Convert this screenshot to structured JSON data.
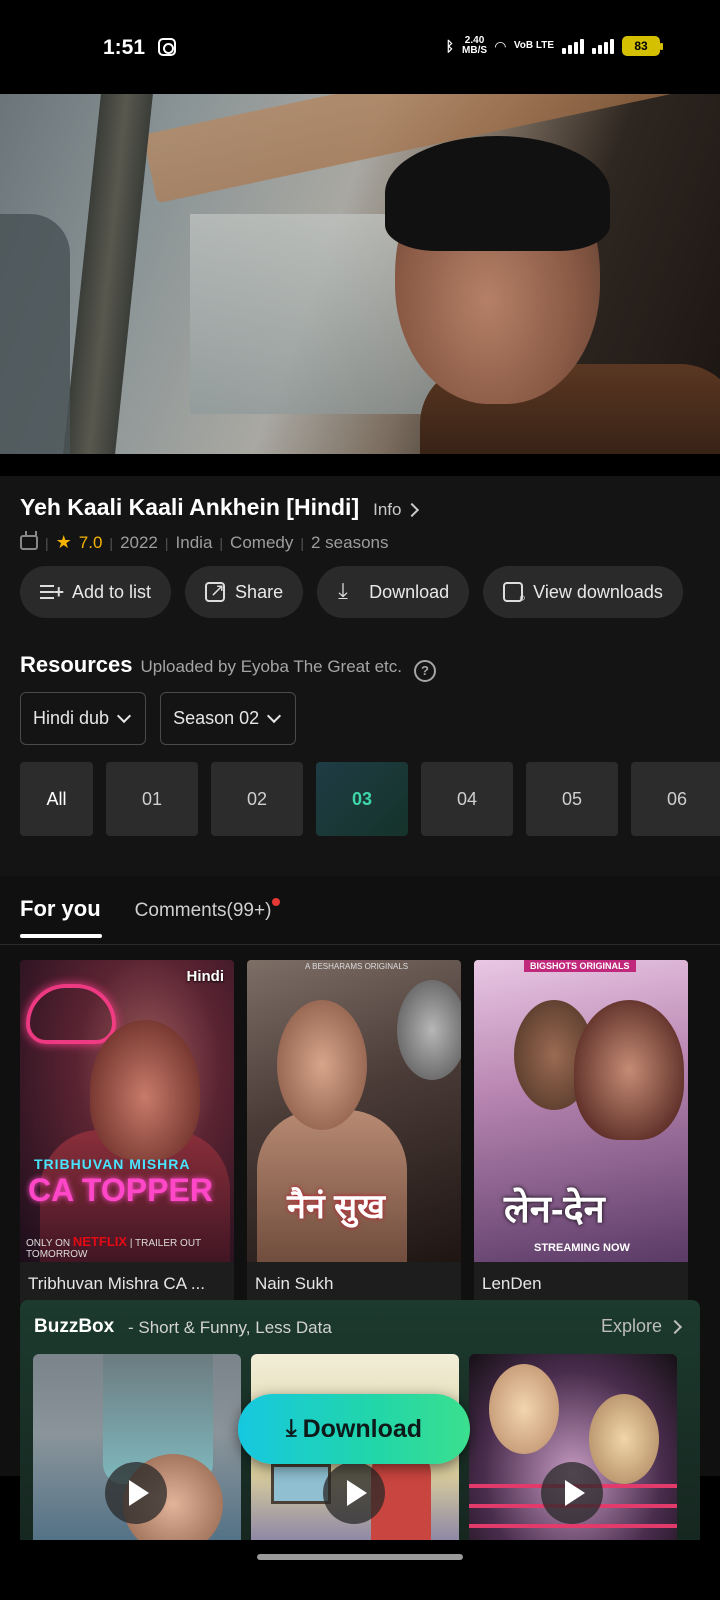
{
  "status_bar": {
    "time": "1:51",
    "network_speed_value": "2.40",
    "network_speed_unit": "MB/S",
    "network_type": "VoB LTE",
    "battery": "83",
    "icons": [
      "instagram-icon",
      "bluetooth-icon",
      "wifi-icon",
      "signal-icon",
      "signal-icon",
      "battery-icon"
    ]
  },
  "show": {
    "title": "Yeh Kaali Kaali Ankhein [Hindi]",
    "info_label": "Info",
    "rating": "7.0",
    "year": "2022",
    "country": "India",
    "genre": "Comedy",
    "seasons": "2 seasons"
  },
  "actions": [
    {
      "label": "Add to list",
      "icon": "add-list-icon"
    },
    {
      "label": "Share",
      "icon": "share-icon"
    },
    {
      "label": "Download",
      "icon": "download-icon"
    },
    {
      "label": "View downloads",
      "icon": "view-downloads-icon"
    }
  ],
  "resources": {
    "title": "Resources",
    "uploaded_by": "Uploaded by  Eyoba The Great etc.",
    "language_select": "Hindi dub",
    "season_select": "Season 02",
    "episodes": [
      "All",
      "01",
      "02",
      "03",
      "04",
      "05",
      "06"
    ],
    "active_episode": "03"
  },
  "tabs": {
    "for_you": "For you",
    "comments": "Comments(99+)"
  },
  "recommendations": [
    {
      "title": "Tribhuvan Mishra CA ...",
      "badge": "Hindi",
      "poster_line1": "TRIBHUVAN MISHRA",
      "poster_line2": "CA TOPPER",
      "poster_footer": "ONLY ON",
      "poster_brand": "NETFLIX",
      "poster_footer2": "TRAILER OUT TOMORROW"
    },
    {
      "title": "Nain Sukh",
      "poster_header": "A BESHARAMS ORIGINALS",
      "poster_title": "नैनं सुख"
    },
    {
      "title": "LenDen",
      "poster_header": "BIGSHOTS ORIGINALS",
      "poster_title": "लेन-देन",
      "poster_footer": "STREAMING NOW"
    }
  ],
  "buzzbox": {
    "title": "BuzzBox",
    "subtitle": "- Short & Funny, Less Data",
    "explore": "Explore"
  },
  "fab": {
    "label": "Download"
  }
}
